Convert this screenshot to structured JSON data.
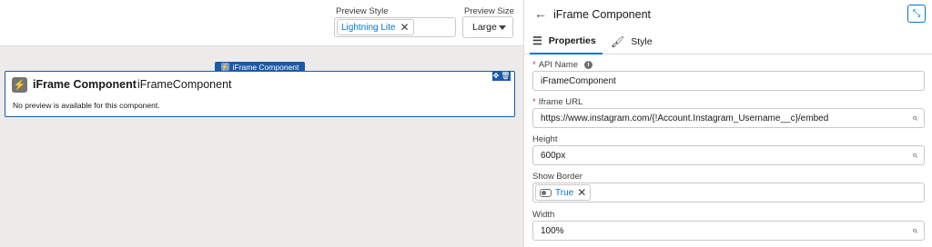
{
  "toolbar": {
    "preview_style_label": "Preview Style",
    "preview_style_value": "Lightning Lite",
    "preview_size_label": "Preview Size",
    "preview_size_value": "Large"
  },
  "canvas": {
    "component_tab_label": "iFrame Component",
    "card_title": "iFrame Component",
    "card_api_name": "iFrameComponent",
    "card_message": "No preview is available for this component."
  },
  "panel": {
    "title": "iFrame Component",
    "tabs": [
      {
        "label": "Properties"
      },
      {
        "label": "Style"
      }
    ],
    "fields": {
      "api_name": {
        "label": "API Name",
        "value": "iFrameComponent"
      },
      "iframe_url": {
        "label": "Iframe URL",
        "value": "https://www.instagram.com/{!Account.Instagram_Username__c}/embed"
      },
      "height": {
        "label": "Height",
        "value": "600px"
      },
      "show_border": {
        "label": "Show Border",
        "value": "True"
      },
      "width": {
        "label": "Width",
        "value": "100%"
      }
    }
  },
  "colors": {
    "accent": "#0176d3",
    "selection": "#1b5aa7",
    "canvas_bg": "#ecebea"
  }
}
